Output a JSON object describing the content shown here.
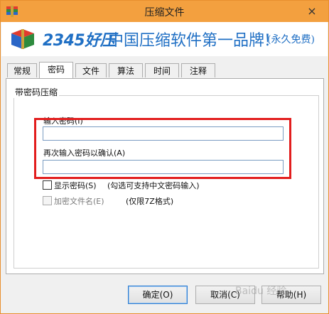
{
  "window": {
    "title": "压缩文件",
    "close_glyph": "×"
  },
  "banner": {
    "brand": "2345好压",
    "slogan": "中国压缩软件第一品牌!",
    "slogan_sub": "(永久免费)"
  },
  "tabs": [
    "常规",
    "密码",
    "文件",
    "算法",
    "时间",
    "注释"
  ],
  "active_tab": "密码",
  "group": {
    "label": "带密码压缩"
  },
  "fields": {
    "password_label": "输入密码(I)",
    "password_value": "",
    "confirm_label": "再次输入密码以确认(A)",
    "confirm_value": ""
  },
  "checkboxes": {
    "show_password_label": "显示密码(S)",
    "show_password_hint": "(勾选可支持中文密码输入)",
    "show_password_checked": false,
    "encrypt_filenames_label": "加密文件名(E)",
    "encrypt_filenames_hint": "(仅限7Z格式)",
    "encrypt_filenames_checked": false
  },
  "buttons": {
    "ok": "确定(O)",
    "cancel": "取消(C)",
    "help": "帮助(H)"
  },
  "watermark": "Baidu 经验",
  "colors": {
    "titlebar": "#f3a03f",
    "highlight": "#e21d1d",
    "brand": "#1f6fc4"
  }
}
